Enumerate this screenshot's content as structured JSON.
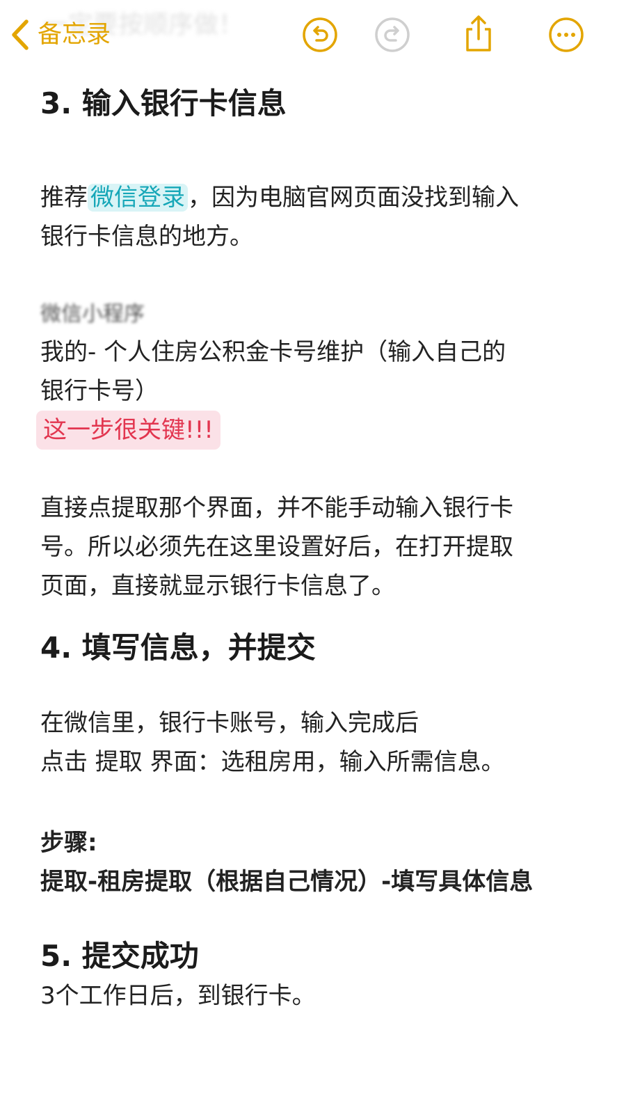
{
  "nav": {
    "back_label": "备忘录",
    "ghost_title": "一定要按顺序做！"
  },
  "accent_color": "#e3a500",
  "icons": [
    "chevron-left-icon",
    "undo-icon",
    "redo-icon",
    "share-icon",
    "more-icon"
  ],
  "note": {
    "s3_title": "3. 输入银行卡信息",
    "s3_p1_a": "推荐",
    "s3_p1_hl": "微信登录",
    "s3_p1_b": "，因为电脑官网页面没找到输入",
    "s3_p1_line2": "银行卡信息的地方。",
    "s3_blur": "微信小程序",
    "s3_p2_line1": "我的- 个人住房公积金卡号维护（输入自己的",
    "s3_p2_line2": "银行卡号）",
    "s3_key": "这一步很关键!!!",
    "s3_p3_line1": "直接点提取那个界面，并不能手动输入银行卡",
    "s3_p3_line2": "号。所以必须先在这里设置好后，在打开提取",
    "s3_p3_line3": "页面，直接就显示银行卡信息了。",
    "s4_title": "4. 填写信息，并提交",
    "s4_p1_line1": "在微信里，银行卡账号，输入完成后",
    "s4_p1_line2": "点击 提取 界面：选租房用，输入所需信息。",
    "s4_steps_label": "步骤:",
    "s4_steps": "提取-租房提取（根据自己情况）-填写具体信息",
    "s5_title": "5. 提交成功",
    "s5_p1": "3个工作日后，到银行卡。"
  }
}
